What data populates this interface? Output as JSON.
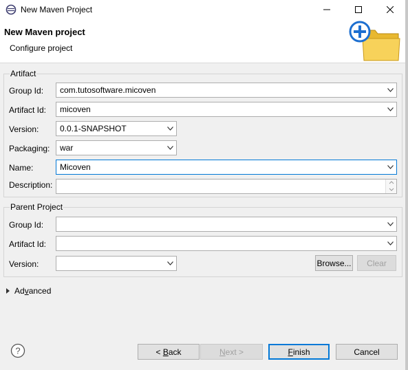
{
  "window": {
    "title": "New Maven Project",
    "controls": [
      "minimize",
      "maximize",
      "close"
    ]
  },
  "header": {
    "title": "New Maven project",
    "subtitle": "Configure project",
    "icon": "new-maven-project-wizard-icon"
  },
  "artifact": {
    "group_label": "Artifact",
    "group_id_label": "Group Id:",
    "group_id_value": "com.tutosoftware.micoven",
    "artifact_id_label": "Artifact Id:",
    "artifact_id_value": "micoven",
    "version_label": "Version:",
    "version_value": "0.0.1-SNAPSHOT",
    "packaging_label": "Packaging:",
    "packaging_value": "war",
    "name_label": "Name:",
    "name_value": "Micoven",
    "description_label": "Description:",
    "description_value": ""
  },
  "parent": {
    "group_label": "Parent Project",
    "group_id_label": "Group Id:",
    "group_id_value": "",
    "artifact_id_label": "Artifact Id:",
    "artifact_id_value": "",
    "version_label": "Version:",
    "version_value": "",
    "browse_label": "Browse...",
    "clear_label": "Clear"
  },
  "advanced": {
    "label_prefix": "Ad",
    "label_mnemonic": "v",
    "label_suffix": "anced"
  },
  "footer": {
    "back_prefix": "< ",
    "back_mnemonic": "B",
    "back_suffix": "ack",
    "next_mnemonic": "N",
    "next_suffix": "ext >",
    "finish_mnemonic": "F",
    "finish_suffix": "inish",
    "cancel_label": "Cancel"
  }
}
